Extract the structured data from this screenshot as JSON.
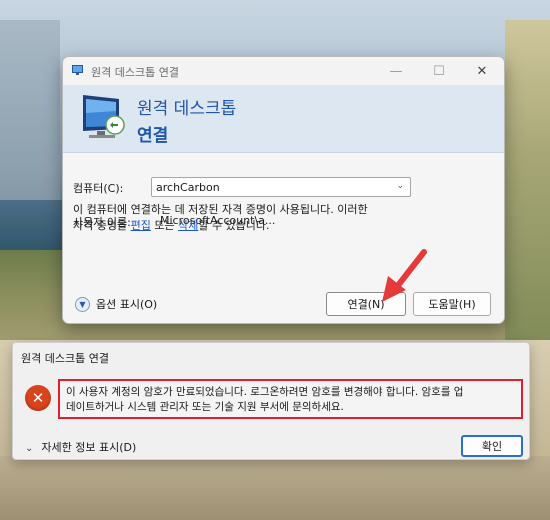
{
  "rdp_window": {
    "title": "원격 데스크톱 연결",
    "banner_line1": "원격 데스크톱",
    "banner_line2": "연결",
    "computer_label": "컴퓨터(C):",
    "computer_value": "archCarbon",
    "username_label": "사용자 이름:",
    "username_value": "MicrosoftAccount\\a...",
    "info_line1": "이 컴퓨터에 연결하는 데 저장된 자격 증명이 사용됩니다. 이러한",
    "info_line2_pre": "자격 증명을 ",
    "info_link_edit": "편집",
    "info_line2_mid": " 또는 ",
    "info_link_delete": "삭제",
    "info_line2_post": "할 수 있습니다.",
    "options_label": "옵션 표시(O)",
    "connect_button": "연결(N)",
    "help_button": "도움말(H)"
  },
  "error_dialog": {
    "title": "원격 데스크톱 연결",
    "message_line1": "이 사용자 계정의 암호가 만료되었습니다. 로그온하려면 암호를 변경해야 합니다. 암호를 업",
    "message_line2": "데이트하거나 시스템 관리자 또는 기술 지원 부서에 문의하세요.",
    "details_label": "자세한 정보 표시(D)",
    "ok_button": "확인"
  },
  "colors": {
    "banner_text": "#1f56a8",
    "error_icon": "#d9441c",
    "highlight_border": "#e0202e",
    "arrow": "#e53a3a",
    "link": "#1a56c8"
  },
  "icons": {
    "app": "remote-desktop-icon",
    "banner": "remote-desktop-monitor-icon",
    "error": "error-x-icon",
    "options": "chevron-down-circle-icon",
    "details": "chevron-down-icon"
  }
}
